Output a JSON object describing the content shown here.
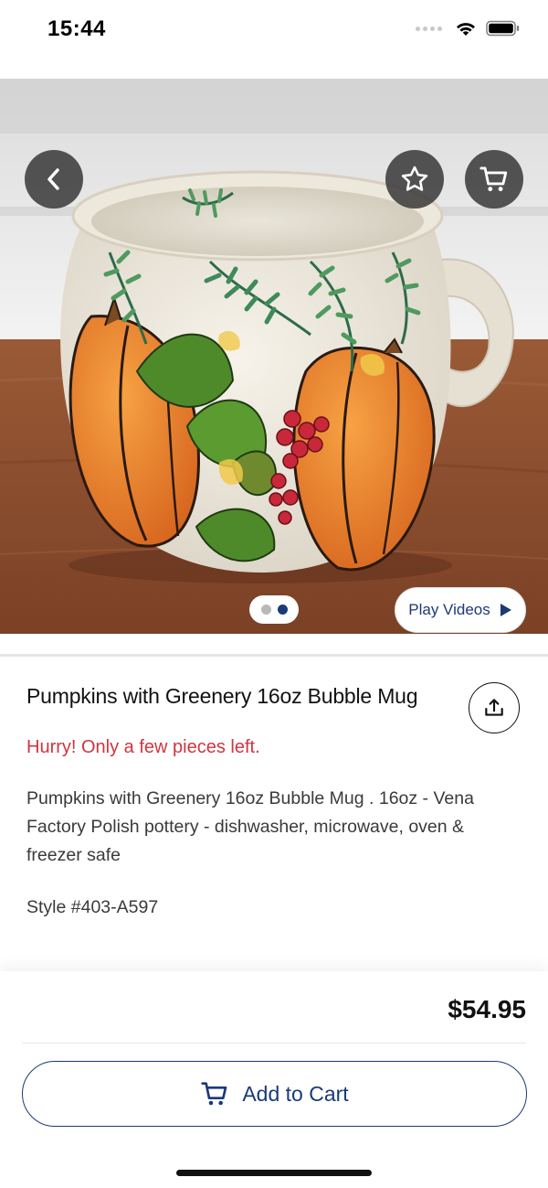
{
  "status_bar": {
    "time": "15:44"
  },
  "hero": {
    "play_videos_label": "Play Videos",
    "pager": {
      "count": 2,
      "active_index": 1
    }
  },
  "product": {
    "title": "Pumpkins with Greenery 16oz Bubble Mug",
    "urgency": "Hurry! Only a few pieces left.",
    "description": "Pumpkins with Greenery 16oz Bubble Mug . 16oz - Vena Factory Polish pottery - dishwasher, microwave, oven & freezer safe",
    "style": "Style #403-A597",
    "price": "$54.95"
  },
  "actions": {
    "add_to_cart_label": "Add to Cart"
  },
  "icons": {
    "back": "chevron-left-icon",
    "favorite": "star-icon",
    "cart": "cart-icon",
    "share": "share-icon",
    "play": "play-triangle-icon"
  },
  "colors": {
    "brand_navy": "#1a3a78",
    "urgency_red": "#d0353f",
    "pager_active": "#1a3a78",
    "pager_inactive": "#b9b9b9",
    "overlay_button": "#373737"
  }
}
